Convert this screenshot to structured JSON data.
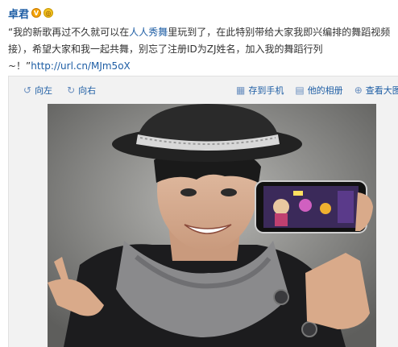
{
  "author": {
    "name": "卓君"
  },
  "post": {
    "line1_before": "“我的新歌再过不久就可以在",
    "line1_link": "人人秀舞",
    "line1_after": "里玩到了，在此特别带给大家我即兴编排的舞蹈视频",
    "line2": "接），希望大家和我一起共舞，别忘了注册ID为ZJ姓名，加入我的舞蹈行列",
    "line3_before": "~！”",
    "line3_link": "http://url.cn/MJm5oX"
  },
  "toolbar": {
    "rotate_left": "向左",
    "rotate_right": "向右",
    "save_to_phone": "存到手机",
    "his_album": "他的相册",
    "view_large": "查看大图"
  }
}
